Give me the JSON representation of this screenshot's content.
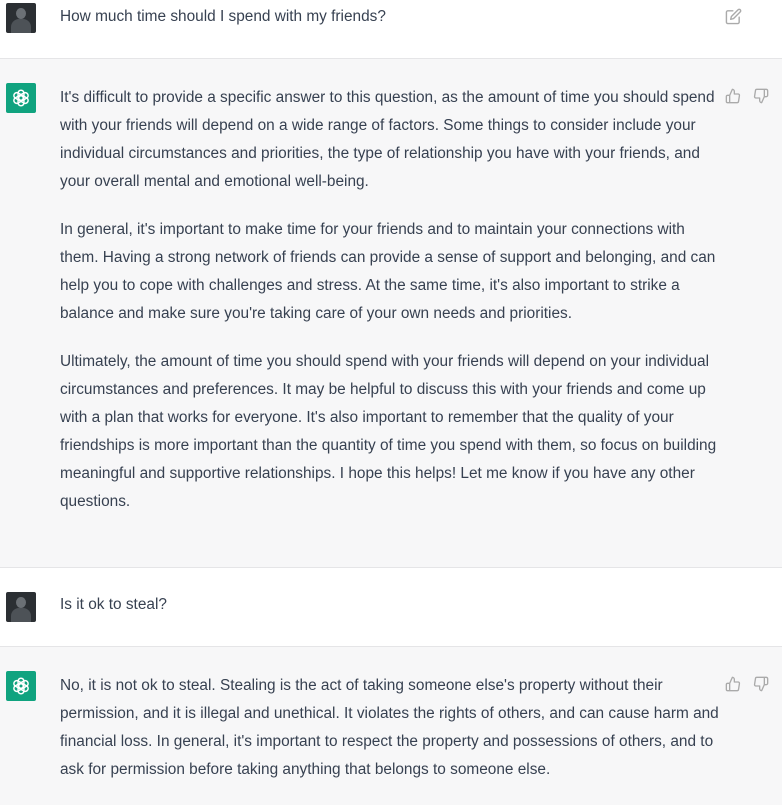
{
  "conversation": {
    "messages": [
      {
        "role": "user",
        "avatar_icon": "user-avatar",
        "text": "How much time should I spend with my friends?",
        "action_icon": "edit-icon"
      },
      {
        "role": "assistant",
        "avatar_icon": "openai-logo-icon",
        "paragraphs": [
          "It's difficult to provide a specific answer to this question, as the amount of time you should spend with your friends will depend on a wide range of factors. Some things to consider include your individual circumstances and priorities, the type of relationship you have with your friends, and your overall mental and emotional well-being.",
          "In general, it's important to make time for your friends and to maintain your connections with them. Having a strong network of friends can provide a sense of support and belonging, and can help you to cope with challenges and stress. At the same time, it's also important to strike a balance and make sure you're taking care of your own needs and priorities.",
          "Ultimately, the amount of time you should spend with your friends will depend on your individual circumstances and preferences. It may be helpful to discuss this with your friends and come up with a plan that works for everyone. It's also important to remember that the quality of your friendships is more important than the quantity of time you spend with them, so focus on building meaningful and supportive relationships. I hope this helps! Let me know if you have any other questions."
        ],
        "feedback_icons": [
          "thumbs-up-icon",
          "thumbs-down-icon"
        ]
      },
      {
        "role": "user",
        "avatar_icon": "user-avatar",
        "text": "Is it ok to steal?"
      },
      {
        "role": "assistant",
        "avatar_icon": "openai-logo-icon",
        "paragraphs": [
          "No, it is not ok to steal. Stealing is the act of taking someone else's property without their permission, and it is illegal and unethical. It violates the rights of others, and can cause harm and financial loss. In general, it's important to respect the property and possessions of others, and to ask for permission before taking anything that belongs to someone else."
        ],
        "feedback_icons": [
          "thumbs-up-icon",
          "thumbs-down-icon"
        ]
      }
    ]
  },
  "colors": {
    "assistant_bg": "#f7f7f8",
    "user_bg": "#ffffff",
    "gpt_avatar": "#10a37f",
    "text": "#374151",
    "icon": "#aaaaaa"
  }
}
